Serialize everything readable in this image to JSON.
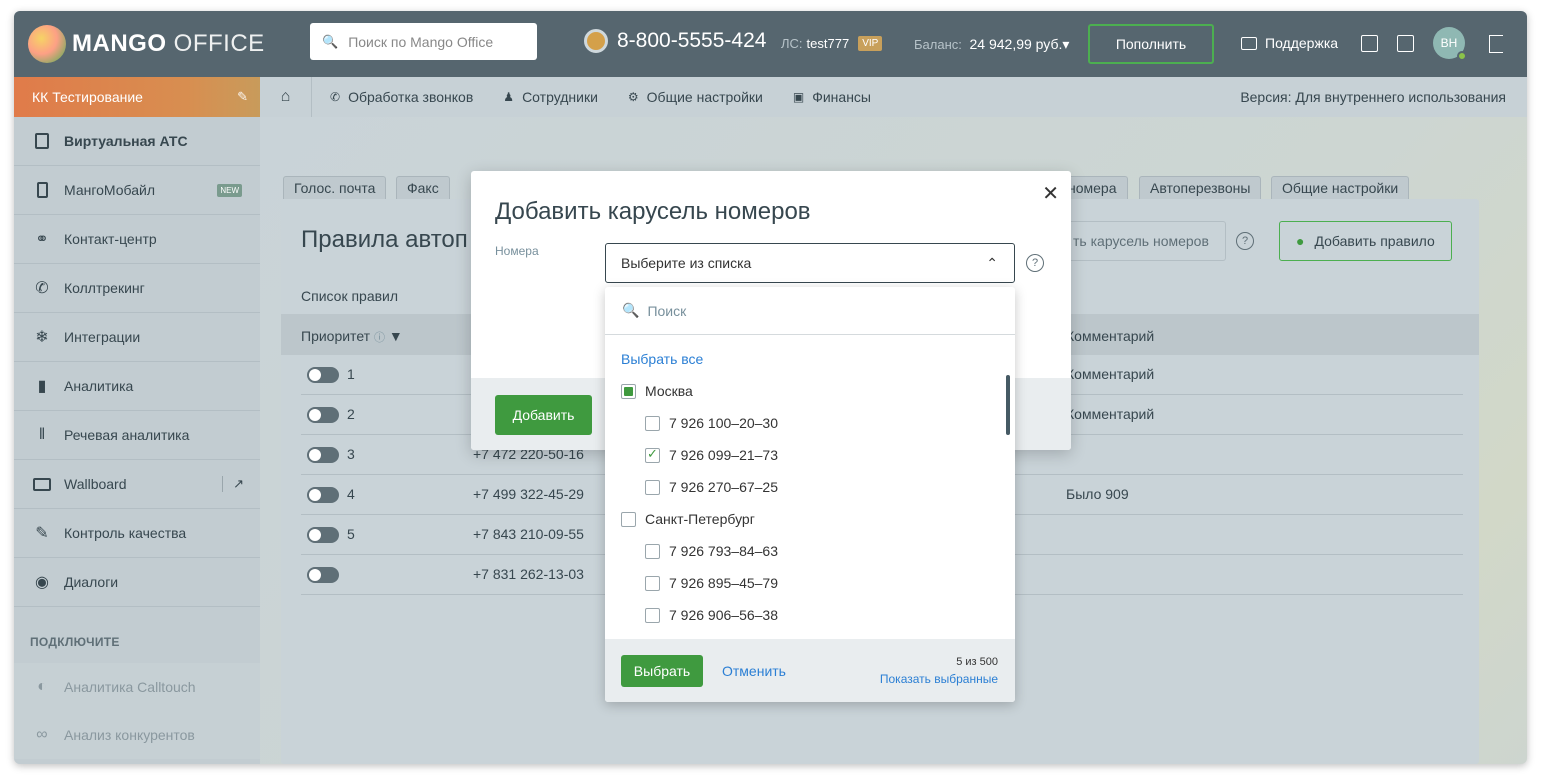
{
  "header": {
    "logo_bold": "MANGO",
    "logo_light": "OFFICE",
    "search_placeholder": "Поиск по Mango Office",
    "phone": "8-800-5555-424",
    "ls_label": "ЛС:",
    "ls_value": "test777",
    "vip": "VIP",
    "balance_label": "Баланс:",
    "balance_value": "24 942,99 руб.▾",
    "topup": "Пополнить",
    "support": "Поддержка",
    "avatar": "ВН"
  },
  "sidebar": {
    "project": "КК Тестирование",
    "items": [
      {
        "label": "Виртуальная АТС",
        "icon": "pbx-icon"
      },
      {
        "label": "МангоМобайл",
        "icon": "mobile-icon",
        "badge": "NEW"
      },
      {
        "label": "Контакт-центр",
        "icon": "headset-icon"
      },
      {
        "label": "Коллтрекинг",
        "icon": "calltracking-icon"
      },
      {
        "label": "Интеграции",
        "icon": "integrations-icon"
      },
      {
        "label": "Аналитика",
        "icon": "analytics-icon"
      },
      {
        "label": "Речевая аналитика",
        "icon": "speech-icon"
      },
      {
        "label": "Wallboard",
        "icon": "monitor-icon"
      },
      {
        "label": "Контроль качества",
        "icon": "quality-icon"
      },
      {
        "label": "Диалоги",
        "icon": "dialogs-icon"
      }
    ],
    "connect_title": "ПОДКЛЮЧИТЕ",
    "connect_items": [
      {
        "label": "Аналитика Calltouch",
        "icon": "calltouch-icon"
      },
      {
        "label": "Анализ конкурентов",
        "icon": "binoculars-icon"
      }
    ]
  },
  "navbar": {
    "items": [
      "Обработка звонков",
      "Сотрудники",
      "Общие настройки",
      "Финансы"
    ],
    "version": "Версия: Для внутреннего использования"
  },
  "tabs": {
    "voice_mail": "Голос. почта",
    "fax": "Факс",
    "numbers_tail": "номера",
    "autocall": "Автоперезвоны",
    "general": "Общие настройки"
  },
  "panel": {
    "title": "Правила автоп",
    "carousel_btn": "ть карусель номеров",
    "add_rule": "Добавить правило",
    "list_label": "Список правил",
    "col_priority": "Приоритет",
    "col_comment": "Комментарий",
    "rows": [
      {
        "priority": "1",
        "number": "",
        "comment": "Комментарий"
      },
      {
        "priority": "2",
        "number": "",
        "comment": "Комментарий"
      },
      {
        "priority": "3",
        "number": "+7 472 220-50-16",
        "comment": ""
      },
      {
        "priority": "4",
        "number": "+7 499 322-45-29",
        "comment": "Было 909"
      },
      {
        "priority": "5",
        "number": "+7 843 210-09-55",
        "comment": ""
      },
      {
        "priority": "",
        "number": "+7 831 262-13-03",
        "comment": ""
      }
    ]
  },
  "modal": {
    "title": "Добавить карусель номеров",
    "field_label": "Номера",
    "select_placeholder": "Выберите из списка",
    "add_button": "Добавить"
  },
  "dropdown": {
    "search_placeholder": "Поиск",
    "select_all": "Выбрать все",
    "groups": [
      {
        "label": "Москва",
        "state": "partial",
        "items": [
          {
            "label": "7 926 100–20–30",
            "checked": false
          },
          {
            "label": "7 926 099–21–73",
            "checked": true
          },
          {
            "label": "7 926 270–67–25",
            "checked": false
          }
        ]
      },
      {
        "label": "Санкт-Петербург",
        "state": "unchecked",
        "items": [
          {
            "label": "7 926 793–84–63",
            "checked": false
          },
          {
            "label": "7 926 895–45–79",
            "checked": false
          },
          {
            "label": "7 926 906–56–38",
            "checked": false
          }
        ]
      }
    ],
    "select_button": "Выбрать",
    "cancel_button": "Отменить",
    "counter": "5 из 500",
    "show_selected": "Показать выбранные"
  }
}
